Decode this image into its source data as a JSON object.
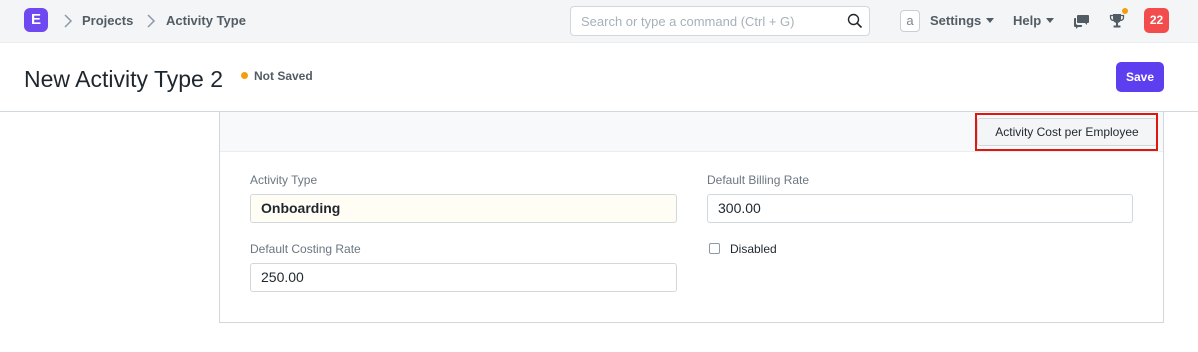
{
  "navbar": {
    "logo_letter": "E",
    "breadcrumbs": [
      "Projects",
      "Activity Type"
    ],
    "search_placeholder": "Search or type a command (Ctrl + G)",
    "avatar_letter": "a",
    "settings_label": "Settings",
    "help_label": "Help",
    "notification_count": "22",
    "accent": "#6e48f0"
  },
  "page": {
    "title": "New Activity Type 2",
    "status": "Not Saved",
    "save_label": "Save"
  },
  "toolbar": {
    "activity_cost_label": "Activity Cost per Employee"
  },
  "form": {
    "activity_type_label": "Activity Type",
    "activity_type_value": "Onboarding",
    "default_billing_rate_label": "Default Billing Rate",
    "default_billing_rate_value": "300.00",
    "default_costing_rate_label": "Default Costing Rate",
    "default_costing_rate_value": "250.00",
    "disabled_label": "Disabled"
  }
}
